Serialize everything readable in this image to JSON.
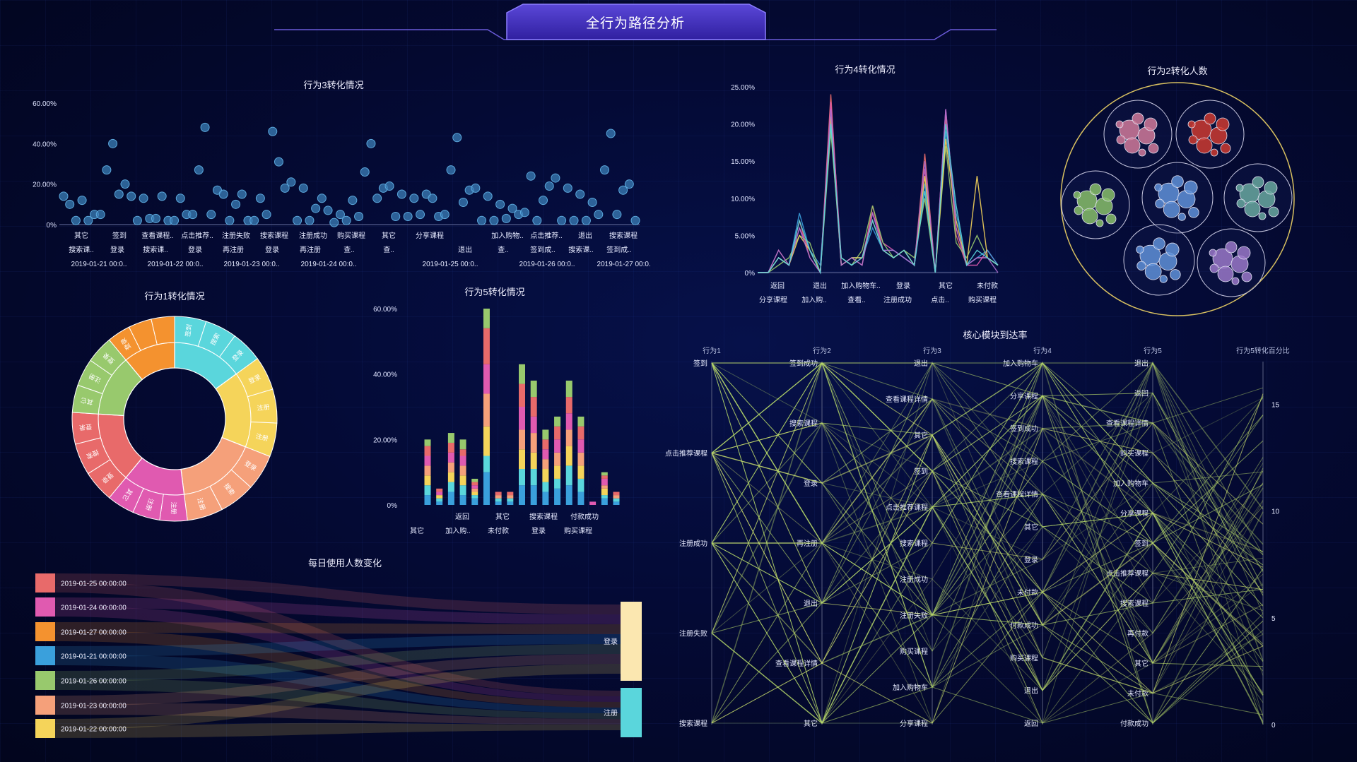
{
  "header": {
    "title": "全行为路径分析"
  },
  "panels": {
    "b3": {
      "title": "行为3转化情况"
    },
    "b4": {
      "title": "行为4转化情况"
    },
    "b2": {
      "title": "行为2转化人数"
    },
    "b1": {
      "title": "行为1转化情况"
    },
    "b5": {
      "title": "行为5转化情况"
    },
    "daily": {
      "title": "每日使用人数变化"
    },
    "core": {
      "title": "核心模块到达率"
    }
  },
  "colors": {
    "palette": [
      "#e86a6a",
      "#e05ab0",
      "#f4922f",
      "#3aa0dc",
      "#98c96d",
      "#f5a07a",
      "#f5d45a",
      "#5ad6dc",
      "#b06fce",
      "#b7a36a"
    ],
    "line_green": "#b6d86a",
    "circle_colors": [
      "#d17a9a",
      "#cc3a30",
      "#88c06a",
      "#5f90d8",
      "#68a8a0",
      "#5f90d8",
      "#9a78c8"
    ]
  },
  "chart_data": [
    {
      "id": "b3",
      "type": "scatter",
      "title": "行为3转化情况",
      "y_ticks": [
        "60.00%",
        "40.00%",
        "20.00%",
        "0%"
      ],
      "ylim": [
        0,
        60
      ],
      "x_labels_row1": [
        "其它",
        "签到",
        "查看课程..",
        "点击推荐..",
        "注册失败",
        "搜索课程",
        "注册成功",
        "购买课程",
        "其它",
        "分享课程",
        "加入购物..",
        "点击推荐..",
        "退出",
        "搜索课程"
      ],
      "x_labels_row2": [
        "搜索课..",
        "登录",
        "搜索课..",
        "登录",
        "再注册",
        "登录",
        "再注册",
        "查..",
        "查..",
        "退出",
        "查..",
        "签到成..",
        "搜索课..",
        "签到成.."
      ],
      "x_labels_row3": [
        "2019-01-21 00:0..",
        "2019-01-22 00:0..",
        "2019-01-23 00:0..",
        "2019-01-24 00:0..",
        "2019-01-25 00:0..",
        "2019-01-26 00:0..",
        "2019-01-27 00:0.."
      ],
      "values": [
        14,
        10,
        2,
        12,
        2,
        5,
        5,
        27,
        40,
        15,
        20,
        14,
        2,
        13,
        3,
        3,
        14,
        2,
        2,
        13,
        5,
        5,
        27,
        48,
        5,
        17,
        15,
        2,
        10,
        15,
        2,
        2,
        13,
        5,
        46,
        31,
        18,
        21,
        2,
        18,
        2,
        8,
        13,
        7,
        1,
        5,
        2,
        12,
        4,
        26,
        40,
        13,
        18,
        19,
        4,
        15,
        4,
        13,
        5,
        15,
        13,
        4,
        5,
        27,
        43,
        11,
        17,
        18,
        2,
        14,
        2,
        10,
        3,
        8,
        5,
        6,
        24,
        2,
        12,
        19,
        23,
        2,
        18,
        2,
        15,
        2,
        11,
        5,
        27,
        45,
        5,
        17,
        20,
        2
      ]
    },
    {
      "id": "b4",
      "type": "line",
      "title": "行为4转化情况",
      "y_ticks": [
        "25.00%",
        "20.00%",
        "15.00%",
        "10.00%",
        "5.00%",
        "0%"
      ],
      "ylim": [
        0,
        25
      ],
      "x_labels_row1": [
        "返回",
        "退出",
        "加入购物车..",
        "登录",
        "其它",
        "未付款"
      ],
      "x_labels_row2": [
        "分享课程",
        "加入购..",
        "查看..",
        "注册成功",
        "点击..",
        "购买课程"
      ],
      "series": [
        {
          "color": "#e86a6a",
          "values": [
            0,
            0,
            3,
            1,
            7,
            2,
            0,
            24,
            1,
            2,
            1,
            9,
            3,
            2,
            3,
            1,
            16,
            0,
            21,
            5,
            1,
            2,
            2,
            1
          ]
        },
        {
          "color": "#e05ab0",
          "values": [
            0,
            0,
            2,
            1,
            6,
            3,
            0,
            23,
            2,
            1,
            2,
            8,
            4,
            3,
            2,
            1,
            14,
            0,
            22,
            6,
            1,
            1,
            3,
            1
          ]
        },
        {
          "color": "#3aa0dc",
          "values": [
            0,
            0,
            2,
            1,
            8,
            3,
            1,
            20,
            1,
            2,
            2,
            6,
            3,
            3,
            2,
            1,
            12,
            0,
            19,
            8,
            1,
            2,
            3,
            1
          ]
        },
        {
          "color": "#98c96d",
          "values": [
            0,
            0,
            1,
            2,
            5,
            4,
            0,
            19,
            2,
            1,
            3,
            9,
            4,
            2,
            3,
            2,
            10,
            0,
            17,
            4,
            2,
            5,
            2,
            1
          ]
        },
        {
          "color": "#f5d45a",
          "values": [
            0,
            0,
            2,
            1,
            5,
            3,
            0,
            21,
            1,
            2,
            2,
            7,
            3,
            2,
            3,
            1,
            13,
            0,
            18,
            7,
            1,
            13,
            2,
            1
          ]
        },
        {
          "color": "#b06fce",
          "values": [
            0,
            0,
            3,
            1,
            6,
            2,
            0,
            22,
            1,
            2,
            1,
            8,
            3,
            3,
            2,
            1,
            15,
            0,
            22,
            6,
            1,
            2,
            2,
            0
          ]
        },
        {
          "color": "#5ad6dc",
          "values": [
            0,
            0,
            2,
            1,
            7,
            3,
            0,
            20,
            2,
            1,
            2,
            7,
            3,
            2,
            3,
            1,
            11,
            0,
            20,
            9,
            1,
            3,
            2,
            1
          ]
        }
      ]
    },
    {
      "id": "b2",
      "type": "circle-packing",
      "title": "行为2转化人数",
      "groups": 7
    },
    {
      "id": "b1",
      "type": "sunburst",
      "title": "行为1转化情况",
      "inner": [
        {
          "label": "",
          "value": 15,
          "color": "#5ad6dc"
        },
        {
          "label": "",
          "value": 16,
          "color": "#f5d45a"
        },
        {
          "label": "",
          "value": 17,
          "color": "#f5a07a"
        },
        {
          "label": "",
          "value": 13,
          "color": "#e05ab0"
        },
        {
          "label": "",
          "value": 15,
          "color": "#e86a6a"
        },
        {
          "label": "",
          "value": 13,
          "color": "#98c96d"
        },
        {
          "label": "",
          "value": 11,
          "color": "#f4922f"
        }
      ],
      "outer_labels": [
        "签到",
        "搜索",
        "登录",
        "登录",
        "注册",
        "注册",
        "登录",
        "搜索",
        "注册",
        "注册",
        "注册",
        "其它",
        "登录",
        "搜索",
        "登录",
        "其它",
        "注册",
        "登录",
        "登录"
      ]
    },
    {
      "id": "b5",
      "type": "bar",
      "stacked": true,
      "title": "行为5转化情况",
      "y_ticks": [
        "60.00%",
        "40.00%",
        "20.00%",
        "0%"
      ],
      "ylim": [
        0,
        60
      ],
      "x_labels_row1": [
        "返回",
        "其它",
        "搜索课程",
        "付款成功"
      ],
      "x_labels_row2": [
        "其它",
        "加入购..",
        "未付款",
        "登录",
        "购买课程"
      ],
      "totals": [
        20,
        5,
        22,
        20,
        8,
        60,
        4,
        4,
        43,
        38,
        23,
        27,
        38,
        27,
        1,
        10,
        4
      ],
      "series": [
        {
          "name": "",
          "color": "#3aa0dc",
          "values": [
            3,
            1,
            4,
            3,
            2,
            10,
            1,
            1,
            6,
            6,
            4,
            5,
            6,
            4,
            0,
            2,
            1
          ]
        },
        {
          "name": "",
          "color": "#5ad6dc",
          "values": [
            3,
            1,
            3,
            3,
            1,
            5,
            1,
            1,
            5,
            5,
            3,
            3,
            6,
            4,
            0,
            1,
            1
          ]
        },
        {
          "name": "",
          "color": "#f5d45a",
          "values": [
            3,
            1,
            3,
            3,
            1,
            9,
            0,
            0,
            6,
            5,
            4,
            4,
            6,
            4,
            0,
            2,
            0
          ]
        },
        {
          "name": "",
          "color": "#f5a07a",
          "values": [
            3,
            0,
            3,
            3,
            1,
            10,
            1,
            1,
            6,
            6,
            3,
            4,
            5,
            4,
            0,
            1,
            1
          ]
        },
        {
          "name": "",
          "color": "#e05ab0",
          "values": [
            3,
            1,
            3,
            3,
            1,
            9,
            0,
            0,
            7,
            5,
            3,
            4,
            5,
            4,
            1,
            2,
            0
          ]
        },
        {
          "name": "",
          "color": "#e86a6a",
          "values": [
            3,
            1,
            3,
            2,
            1,
            11,
            1,
            1,
            7,
            6,
            3,
            4,
            5,
            4,
            0,
            1,
            1
          ]
        },
        {
          "name": "",
          "color": "#98c96d",
          "values": [
            2,
            0,
            3,
            3,
            1,
            6,
            0,
            0,
            6,
            5,
            3,
            3,
            5,
            3,
            0,
            1,
            0
          ]
        }
      ]
    },
    {
      "id": "daily",
      "type": "sankey",
      "title": "每日使用人数变化",
      "sources": [
        {
          "label": "2019-01-25 00:00:00",
          "color": "#e86a6a"
        },
        {
          "label": "2019-01-24 00:00:00",
          "color": "#e05ab0"
        },
        {
          "label": "2019-01-27 00:00:00",
          "color": "#f4922f"
        },
        {
          "label": "2019-01-21 00:00:00",
          "color": "#3aa0dc"
        },
        {
          "label": "2019-01-26 00:00:00",
          "color": "#98c96d"
        },
        {
          "label": "2019-01-23 00:00:00",
          "color": "#f5a07a"
        },
        {
          "label": "2019-01-22 00:00:00",
          "color": "#f5d45a"
        }
      ],
      "targets": [
        {
          "label": "登录",
          "color": "#fbe7b0"
        },
        {
          "label": "注册",
          "color": "#5ad6dc"
        }
      ]
    },
    {
      "id": "core",
      "type": "parallel",
      "title": "核心模块到达率",
      "axes": [
        "行为1",
        "行为2",
        "行为3",
        "行为4",
        "行为5",
        "行为5转化百分比"
      ],
      "categories": [
        [
          "签到",
          "点击推荐课程",
          "注册成功",
          "注册失败",
          "搜索课程"
        ],
        [
          "签到成功",
          "搜索课程",
          "登录",
          "再注册",
          "退出",
          "查看课程详情",
          "其它"
        ],
        [
          "退出",
          "查看课程详情",
          "其它",
          "签到",
          "点击推荐课程",
          "搜索课程",
          "注册成功",
          "注册失败",
          "购买课程",
          "加入购物车",
          "分享课程"
        ],
        [
          "加入购物车",
          "分享课程",
          "签到成功",
          "搜索课程",
          "查看课程详情",
          "其它",
          "登录",
          "未付款",
          "付款成功",
          "购买课程",
          "退出",
          "返回"
        ],
        [
          "退出",
          "返回",
          "查看课程详情",
          "购买课程",
          "加入购物车",
          "分享课程",
          "签到",
          "点击推荐课程",
          "搜索课程",
          "再付款",
          "其它",
          "未付款",
          "付款成功"
        ]
      ],
      "y_ticks": [
        "15",
        "10",
        "5",
        "0"
      ],
      "ylim": [
        0,
        17
      ]
    }
  ]
}
